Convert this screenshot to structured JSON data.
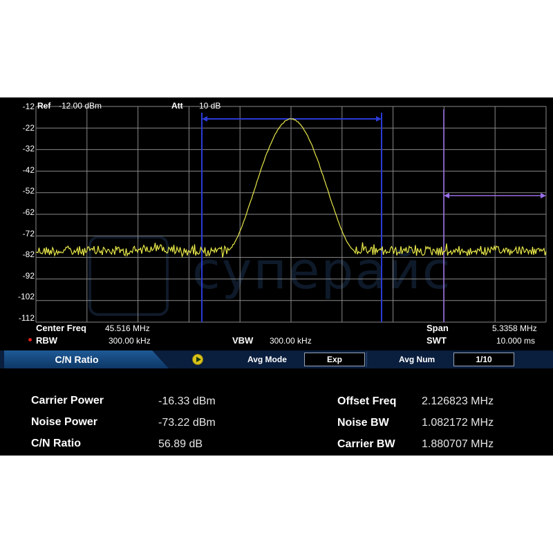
{
  "header": {
    "ref_label": "Ref",
    "ref_value": "-12.00 dBm",
    "att_label": "Att",
    "att_value": "10 dB"
  },
  "y_axis_labels": [
    "-12",
    "-22",
    "-32",
    "-42",
    "-52",
    "-62",
    "-72",
    "-82",
    "-92",
    "-102",
    "-112"
  ],
  "settings": {
    "center_freq_label": "Center Freq",
    "center_freq_value": "45.516 MHz",
    "span_label": "Span",
    "span_value": "5.3358 MHz",
    "rbw_label": "RBW",
    "rbw_value": "300.00 kHz",
    "vbw_label": "VBW",
    "vbw_value": "300.00 kHz",
    "swt_label": "SWT",
    "swt_value": "10.000 ms"
  },
  "function_bar": {
    "title": "C/N Ratio",
    "avg_mode_label": "Avg Mode",
    "avg_mode_value": "Exp",
    "avg_num_label": "Avg Num",
    "avg_num_value": "1/10"
  },
  "results": {
    "carrier_power_label": "Carrier Power",
    "carrier_power_value": "-16.33 dBm",
    "noise_power_label": "Noise Power",
    "noise_power_value": "-73.22 dBm",
    "cn_ratio_label": "C/N Ratio",
    "cn_ratio_value": "56.89 dB",
    "offset_freq_label": "Offset Freq",
    "offset_freq_value": "2.126823 MHz",
    "noise_bw_label": "Noise BW",
    "noise_bw_value": "1.082172 MHz",
    "carrier_bw_label": "Carrier BW",
    "carrier_bw_value": "1.880707 MHz"
  },
  "watermark": {
    "text": "суперайс"
  },
  "colors": {
    "trace": "#e8e84a",
    "carrier_marker": "#2b3bd6",
    "noise_marker": "#9a6ee8",
    "grid": "#8a8a8a"
  }
}
